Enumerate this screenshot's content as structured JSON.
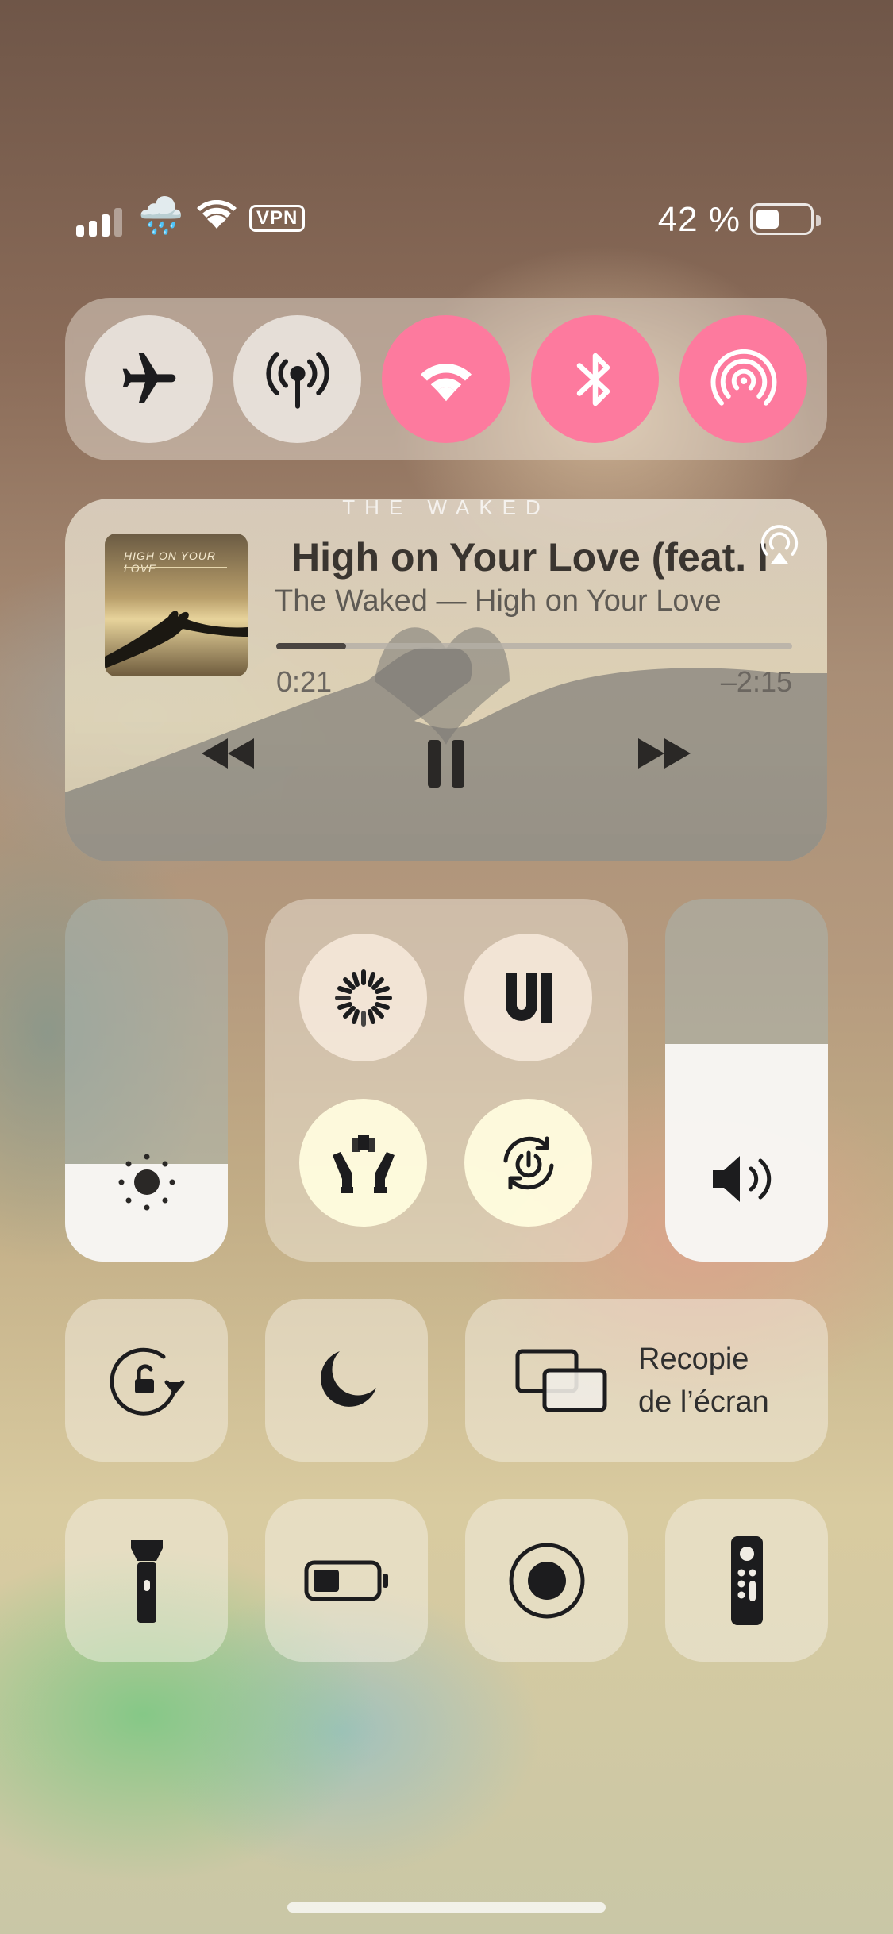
{
  "status_bar": {
    "signal_bars": 3,
    "signal_bars_total": 4,
    "weather_icon": "rain-cloud-icon",
    "wifi_icon": "wifi-icon",
    "vpn": "VPN",
    "battery_percent_label": "42 %",
    "battery_level": 0.42
  },
  "connectivity": {
    "buttons": [
      {
        "icon": "airplane-icon",
        "state": "off"
      },
      {
        "icon": "cellular-antenna-icon",
        "state": "off"
      },
      {
        "icon": "wifi-icon",
        "state": "on"
      },
      {
        "icon": "bluetooth-icon",
        "state": "on"
      },
      {
        "icon": "airdrop-icon",
        "state": "on"
      }
    ],
    "active_color": "#fd7a9e"
  },
  "now_playing": {
    "brand_banner": "THE WAKED",
    "album_art_title": "HIGH ON YOUR LOVE",
    "title": "High on Your Love (feat. I",
    "subtitle": "The Waked — High on Your Love",
    "elapsed": "0:21",
    "remaining": "–2:15",
    "progress": 0.135,
    "controls": [
      "rewind-icon",
      "pause-icon",
      "fast-forward-icon"
    ],
    "airplay_icon": "airplay-audio-icon"
  },
  "brightness": {
    "icon": "sun-icon",
    "level": 0.27
  },
  "volume": {
    "icon": "speaker-volume-icon",
    "level": 0.6
  },
  "toggle_grid": [
    {
      "icon": "loading-spinner-icon"
    },
    {
      "icon": "ui-app-icon"
    },
    {
      "icon": "hands-shield-icon"
    },
    {
      "icon": "power-cycle-icon"
    }
  ],
  "row3": {
    "rotation_lock_icon": "rotation-lock-icon",
    "focus_icon": "moon-icon",
    "screen_mirroring": {
      "icon": "screen-mirroring-icon",
      "line1": "Recopie",
      "line2": "de l’écran"
    }
  },
  "row4": [
    {
      "icon": "flashlight-icon"
    },
    {
      "icon": "low-power-battery-icon"
    },
    {
      "icon": "screen-record-icon"
    },
    {
      "icon": "apple-tv-remote-icon"
    }
  ]
}
